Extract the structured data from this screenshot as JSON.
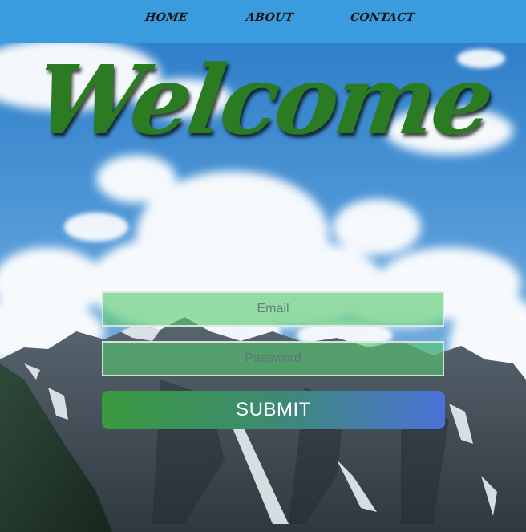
{
  "nav": {
    "items": [
      {
        "label": "HOME"
      },
      {
        "label": "ABOUT"
      },
      {
        "label": "CONTACT"
      }
    ]
  },
  "hero": {
    "title": "Welcome"
  },
  "form": {
    "email_placeholder": "Email",
    "password_placeholder": "Password",
    "submit_label": "SUBMIT"
  },
  "colors": {
    "nav_background": "#3a9cde",
    "title_green": "#2a7b22",
    "field_fill": "#55c86e",
    "submit_gradient_start": "#3a9a3e",
    "submit_gradient_end": "#4a72d8"
  }
}
